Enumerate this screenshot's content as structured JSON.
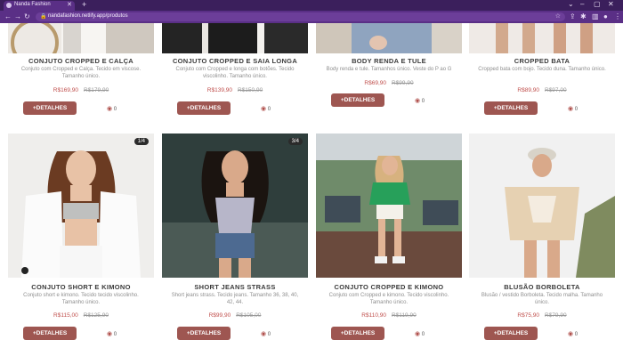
{
  "browser": {
    "tab_title": "Nanda Fashion",
    "tab_close": "✕",
    "new_tab": "+",
    "url": "nandafashion.netlify.app/produtos",
    "window_controls": [
      "⌄",
      "–",
      "▢",
      "✕"
    ]
  },
  "ui": {
    "details_label": "+DETALHES",
    "views_icon": "eye-icon"
  },
  "products": [
    {
      "title": "CONJUTO CROPPED E CALÇA",
      "desc": "Conjuto com Cropped e Calça. Tecido em viscose. Tamanho único.",
      "price": "R$169,90",
      "old_price": "R$179,90",
      "views": "0"
    },
    {
      "title": "CONJUTO CROPPED E SAIA LONGA",
      "desc": "Conjuto com Cropped e longa com botões. Tecido viscolinho. Tamanho único.",
      "price": "R$139,90",
      "old_price": "R$150,90",
      "views": "0"
    },
    {
      "title": "BODY RENDA E TULE",
      "desc": "Body renda e tule. Tamanhos único. Veste do P ao G",
      "price": "R$69,90",
      "old_price": "R$99,90",
      "views": "0"
    },
    {
      "title": "CROPPED BATA",
      "desc": "Cropped bata com bojo. Tecido duna. Tamanho único.",
      "price": "R$89,90",
      "old_price": "R$97,00",
      "views": "0"
    },
    {
      "title": "CONJUTO SHORT E KIMONO",
      "desc": "Conjuto short e kimono. Tecido tecido viscolinho. Tamanho único.",
      "price": "R$115,00",
      "old_price": "R$125,90",
      "views": "0",
      "badge": "1/4"
    },
    {
      "title": "SHORT JEANS STRASS",
      "desc": "Short jeans strass. Tecido jeans. Tamanho 36, 38, 40, 42, 44.",
      "price": "R$99,90",
      "old_price": "R$105,00",
      "views": "0",
      "badge": "3/4"
    },
    {
      "title": "CONJUTO CROPPED E KIMONO",
      "desc": "Conjuto com Cropped e kimono. Tecido viscolinho. Tamanho único.",
      "price": "R$110,90",
      "old_price": "R$119,90",
      "views": "0"
    },
    {
      "title": "BLUSÃO BORBOLETA",
      "desc": "Blusão / vestido Borboleta. Tecido malha. Tamanho único.",
      "price": "R$75,90",
      "old_price": "R$79,90",
      "views": "0"
    }
  ]
}
